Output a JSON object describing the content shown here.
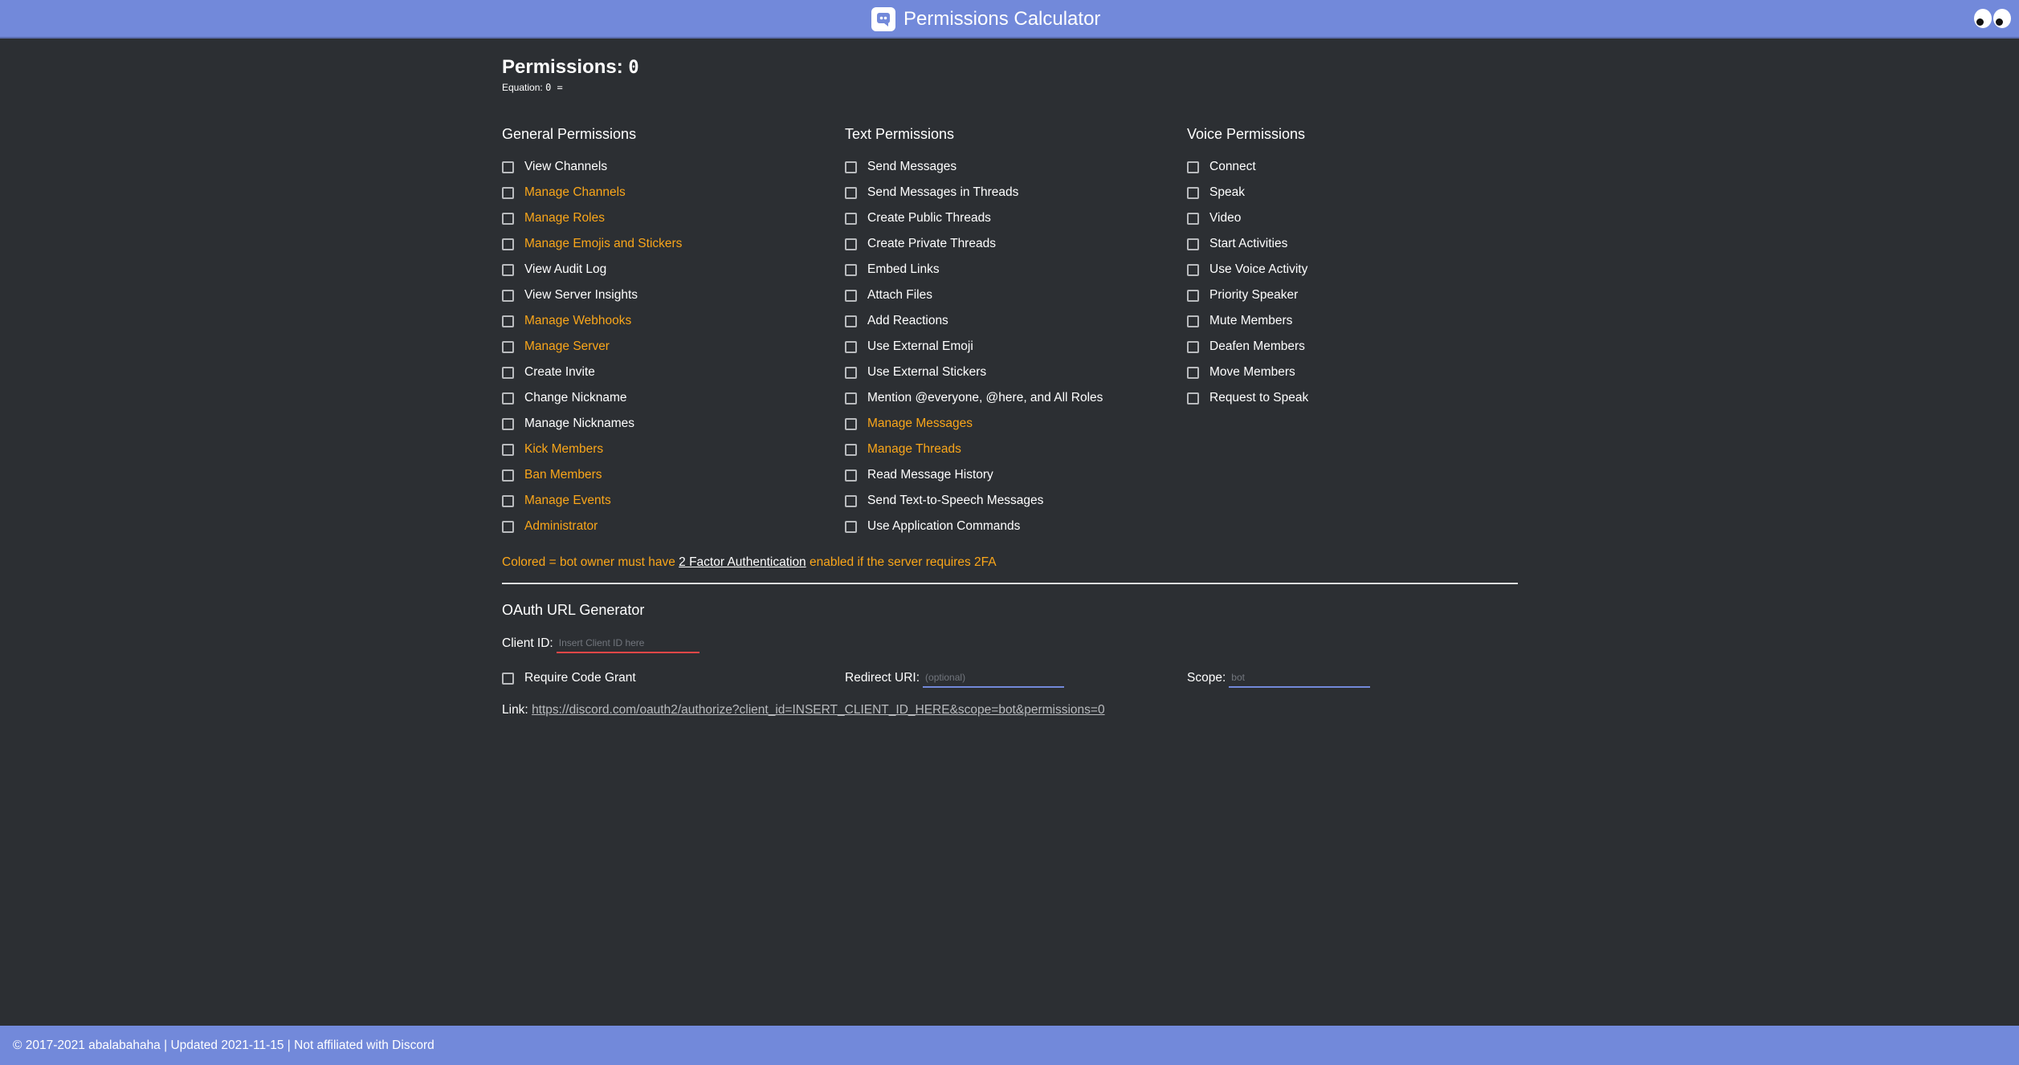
{
  "header": {
    "title": "Permissions Calculator",
    "logo_icon": "discord-logo-icon",
    "eyes_icon": "googly-eyes-icon",
    "bar_color": "#7289da"
  },
  "permissions": {
    "label": "Permissions:",
    "value": "0"
  },
  "equation": {
    "label": "Equation:",
    "value": "0 ="
  },
  "columns": {
    "general": {
      "title": "General Permissions",
      "items": [
        {
          "label": "View Channels",
          "colored": false
        },
        {
          "label": "Manage Channels",
          "colored": true
        },
        {
          "label": "Manage Roles",
          "colored": true
        },
        {
          "label": "Manage Emojis and Stickers",
          "colored": true
        },
        {
          "label": "View Audit Log",
          "colored": false
        },
        {
          "label": "View Server Insights",
          "colored": false
        },
        {
          "label": "Manage Webhooks",
          "colored": true
        },
        {
          "label": "Manage Server",
          "colored": true
        },
        {
          "label": "Create Invite",
          "colored": false
        },
        {
          "label": "Change Nickname",
          "colored": false
        },
        {
          "label": "Manage Nicknames",
          "colored": false
        },
        {
          "label": "Kick Members",
          "colored": true
        },
        {
          "label": "Ban Members",
          "colored": true
        },
        {
          "label": "Manage Events",
          "colored": true
        },
        {
          "label": "Administrator",
          "colored": true
        }
      ]
    },
    "text": {
      "title": "Text Permissions",
      "items": [
        {
          "label": "Send Messages",
          "colored": false
        },
        {
          "label": "Send Messages in Threads",
          "colored": false
        },
        {
          "label": "Create Public Threads",
          "colored": false
        },
        {
          "label": "Create Private Threads",
          "colored": false
        },
        {
          "label": "Embed Links",
          "colored": false
        },
        {
          "label": "Attach Files",
          "colored": false
        },
        {
          "label": "Add Reactions",
          "colored": false
        },
        {
          "label": "Use External Emoji",
          "colored": false
        },
        {
          "label": "Use External Stickers",
          "colored": false
        },
        {
          "label": "Mention @everyone, @here, and All Roles",
          "colored": false
        },
        {
          "label": "Manage Messages",
          "colored": true
        },
        {
          "label": "Manage Threads",
          "colored": true
        },
        {
          "label": "Read Message History",
          "colored": false
        },
        {
          "label": "Send Text-to-Speech Messages",
          "colored": false
        },
        {
          "label": "Use Application Commands",
          "colored": false
        }
      ]
    },
    "voice": {
      "title": "Voice Permissions",
      "items": [
        {
          "label": "Connect",
          "colored": false
        },
        {
          "label": "Speak",
          "colored": false
        },
        {
          "label": "Video",
          "colored": false
        },
        {
          "label": "Start Activities",
          "colored": false
        },
        {
          "label": "Use Voice Activity",
          "colored": false
        },
        {
          "label": "Priority Speaker",
          "colored": false
        },
        {
          "label": "Mute Members",
          "colored": false
        },
        {
          "label": "Deafen Members",
          "colored": false
        },
        {
          "label": "Move Members",
          "colored": false
        },
        {
          "label": "Request to Speak",
          "colored": false
        }
      ]
    }
  },
  "note": {
    "before": "Colored = bot owner must have ",
    "link": "2 Factor Authentication",
    "after": " enabled if the server requires 2FA",
    "color": "#faa61a"
  },
  "oauth": {
    "title": "OAuth URL Generator",
    "client_id_label": "Client ID:",
    "client_id_placeholder": "Insert Client ID here",
    "client_id_value": "",
    "code_grant_label": "Require Code Grant",
    "redirect_label": "Redirect URI:",
    "redirect_placeholder": "(optional)",
    "scope_label": "Scope:",
    "scope_placeholder": "bot",
    "link_label": "Link:",
    "link_url": "https://discord.com/oauth2/authorize?client_id=INSERT_CLIENT_ID_HERE&scope=bot&permissions=0"
  },
  "footer": {
    "text": "© 2017-2021 abalabahaha | Updated 2021-11-15 | Not affiliated with Discord"
  }
}
